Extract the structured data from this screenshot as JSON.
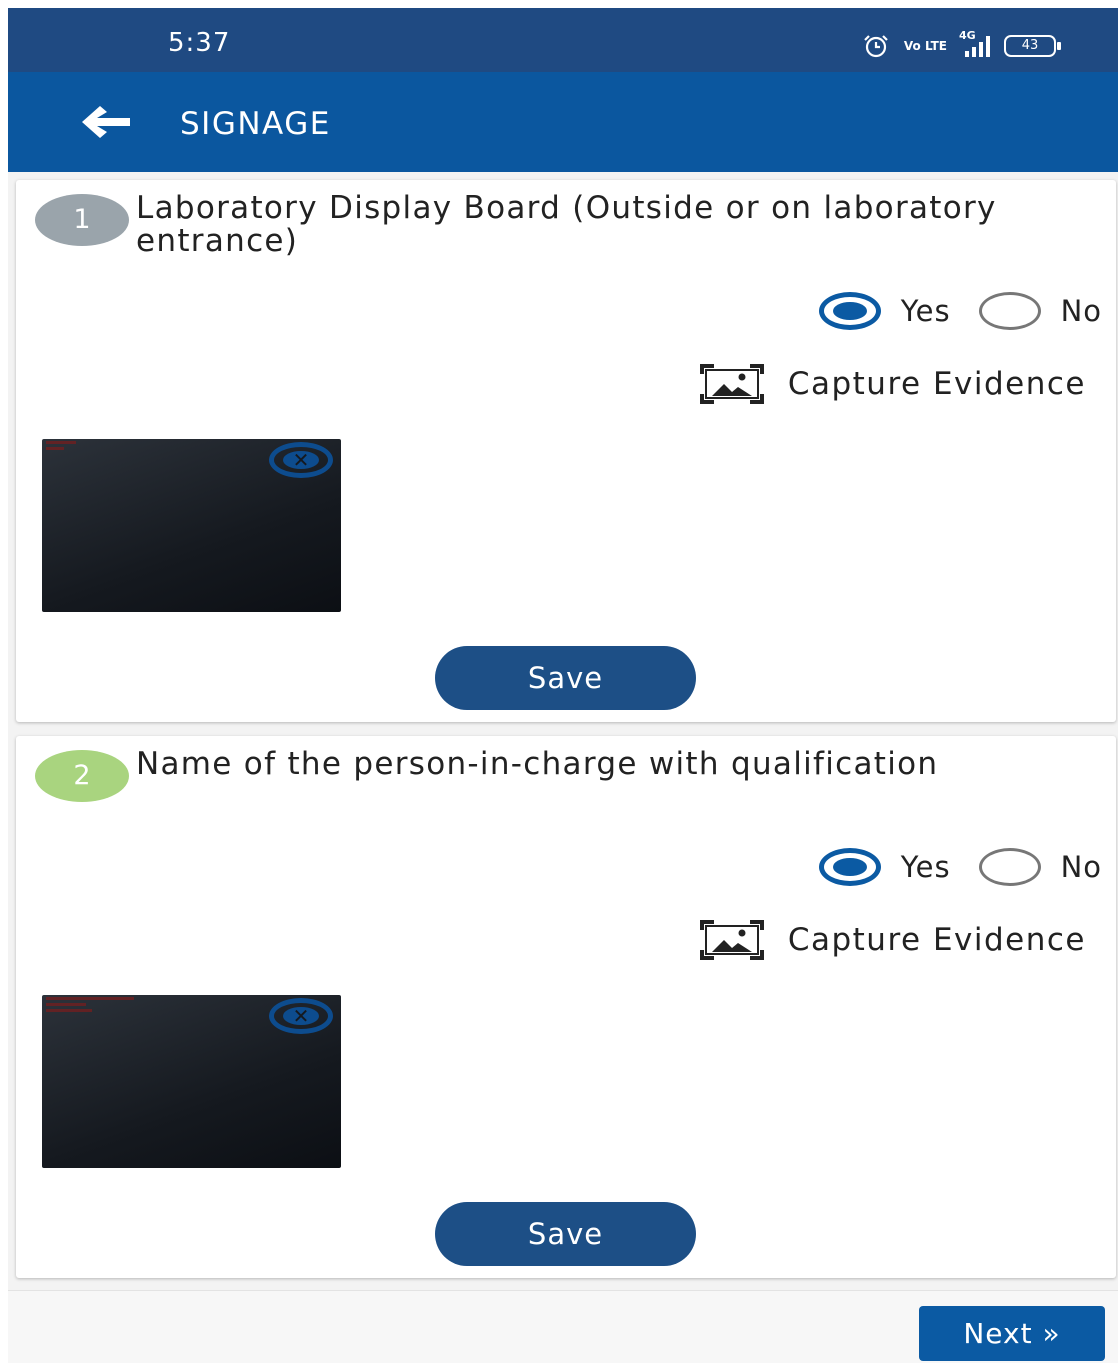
{
  "status_bar": {
    "time": "5:37",
    "network": "4G",
    "volte": "Vo LTE",
    "battery": "43"
  },
  "app_bar": {
    "title": "SIGNAGE"
  },
  "questions": [
    {
      "number": "1",
      "number_color": "#9aa4ab",
      "text": "Laboratory Display Board (Outside or on laboratory entrance)",
      "yes_label": "Yes",
      "no_label": "No",
      "selected": "Yes",
      "capture_label": "Capture Evidence",
      "save_label": "Save"
    },
    {
      "number": "2",
      "number_color": "#a9d47f",
      "text": "Name of the person-in-charge with qualification",
      "yes_label": "Yes",
      "no_label": "No",
      "selected": "Yes",
      "capture_label": "Capture Evidence",
      "save_label": "Save"
    }
  ],
  "footer": {
    "next_label": "Next »"
  },
  "colors": {
    "status_bar": "#1f4a82",
    "app_bar": "#0b579f",
    "primary": "#0b5aa3",
    "save_button": "#1d4f86"
  }
}
